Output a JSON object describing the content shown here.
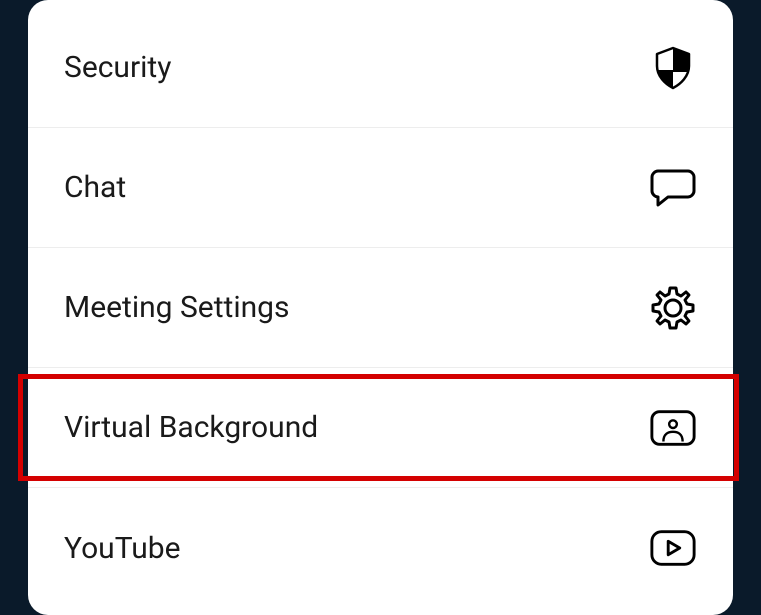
{
  "menu": {
    "items": [
      {
        "label": "Security"
      },
      {
        "label": "Chat"
      },
      {
        "label": "Meeting Settings"
      },
      {
        "label": "Virtual Background"
      },
      {
        "label": "YouTube"
      }
    ]
  }
}
